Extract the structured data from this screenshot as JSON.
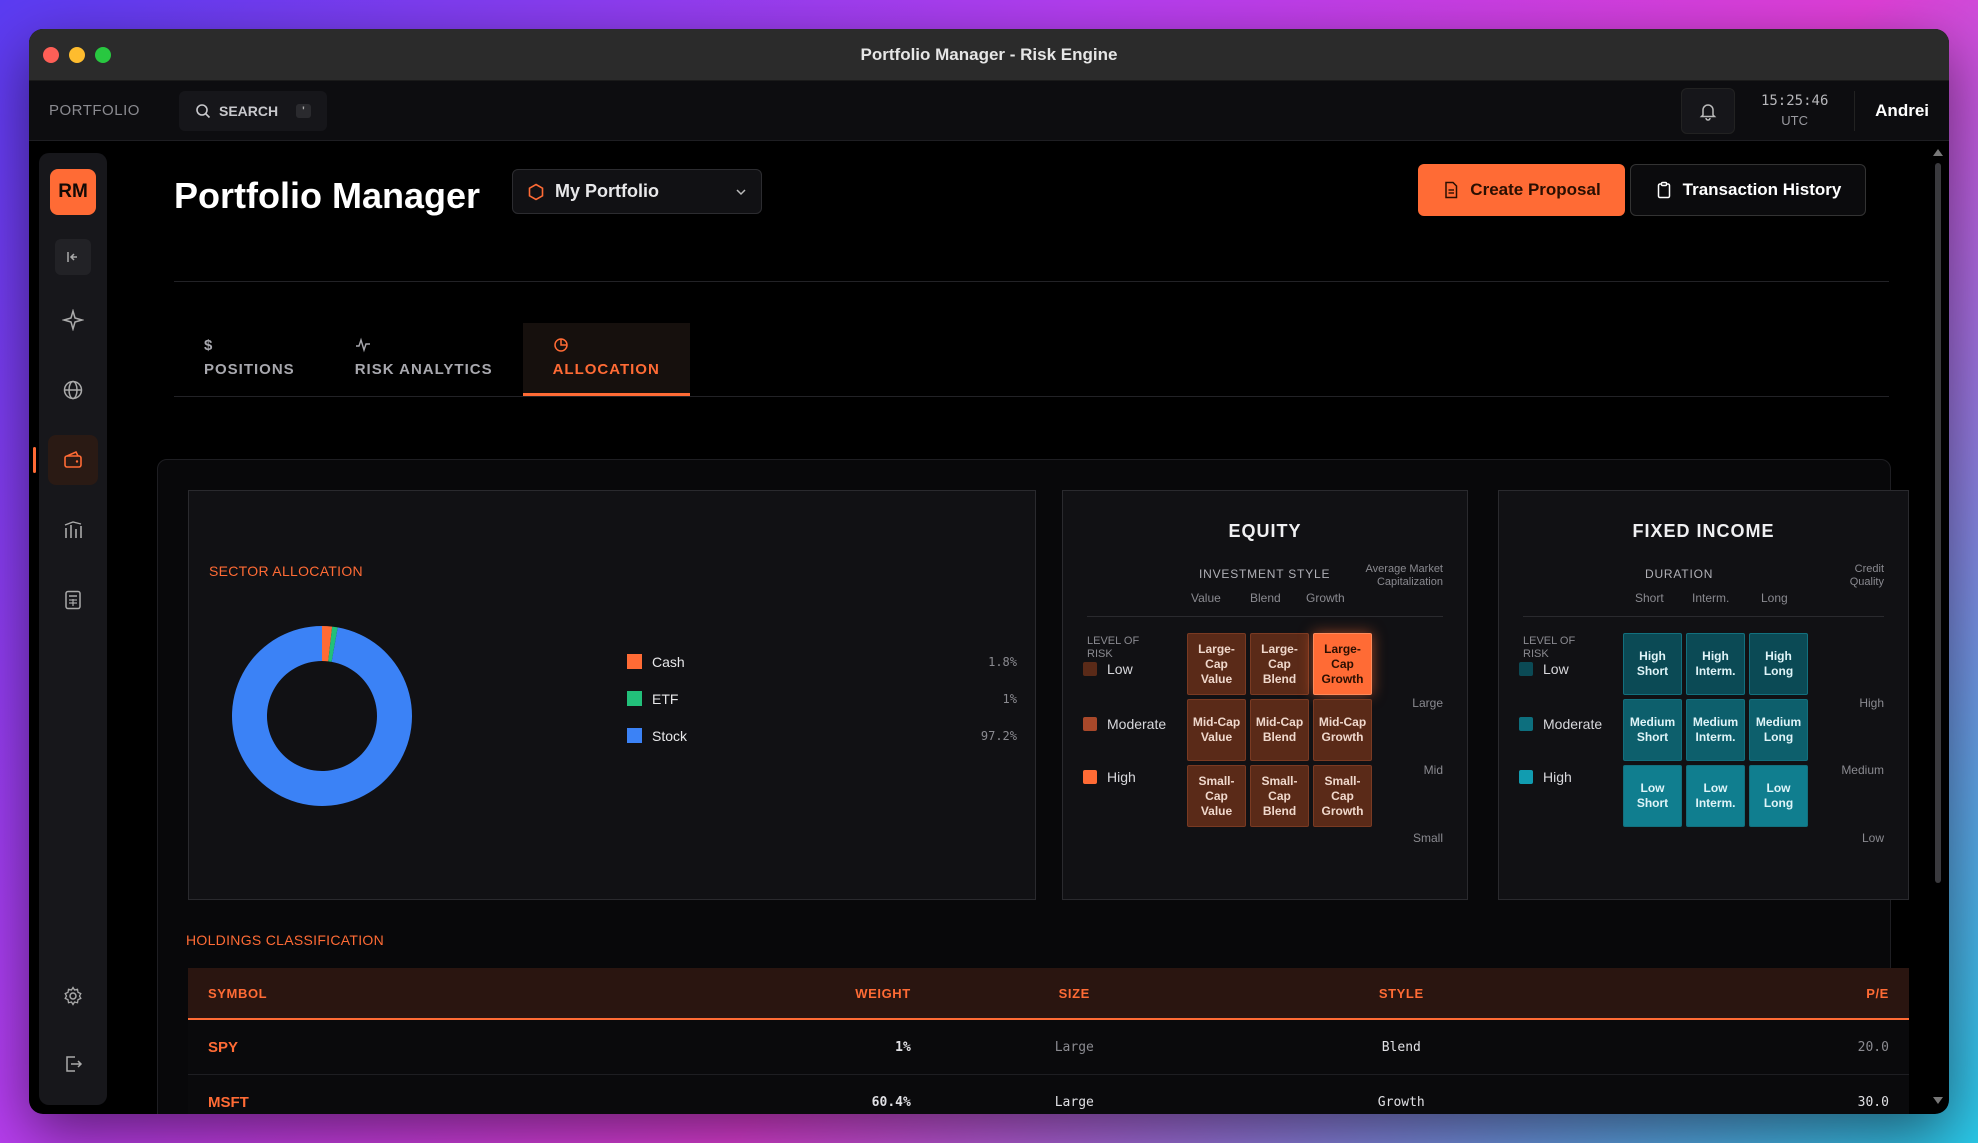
{
  "window": {
    "title": "Portfolio Manager - Risk Engine"
  },
  "topbar": {
    "brand": "PORTFOLIO",
    "search_label": "SEARCH",
    "search_kbd": "'",
    "time": "15:25:46",
    "timezone": "UTC",
    "user": "Andrei"
  },
  "sidebar": {
    "avatar": "RM",
    "items": [
      {
        "name": "collapse",
        "icon": "collapse-icon"
      },
      {
        "name": "sparkle",
        "icon": "sparkle-icon"
      },
      {
        "name": "globe",
        "icon": "globe-icon"
      },
      {
        "name": "wallet",
        "icon": "wallet-icon",
        "active": true
      },
      {
        "name": "analytics",
        "icon": "chart-icon"
      },
      {
        "name": "calculator",
        "icon": "calculator-icon"
      }
    ],
    "bottom": [
      {
        "icon": "gear-icon"
      },
      {
        "icon": "logout-icon"
      }
    ]
  },
  "header": {
    "title": "Portfolio Manager",
    "portfolio_select": "My Portfolio",
    "create_proposal": "Create Proposal",
    "transaction_history": "Transaction History"
  },
  "tabs": [
    {
      "label": "POSITIONS",
      "icon": "$"
    },
    {
      "label": "RISK ANALYTICS",
      "icon": "pulse-icon"
    },
    {
      "label": "ALLOCATION",
      "icon": "pie-icon",
      "active": true
    }
  ],
  "sector": {
    "label": "SECTOR ALLOCATION",
    "items": [
      {
        "name": "Cash",
        "pct": "1.8%",
        "value": 1.8,
        "color": "#ff6b35"
      },
      {
        "name": "ETF",
        "pct": "1%",
        "value": 1.0,
        "color": "#22c07a"
      },
      {
        "name": "Stock",
        "pct": "97.2%",
        "value": 97.2,
        "color": "#3b82f6"
      }
    ]
  },
  "equity": {
    "title": "EQUITY",
    "investment_style": "INVESTMENT STYLE",
    "avg_cap_1": "Average Market",
    "avg_cap_2": "Capitalization",
    "cols": [
      "Value",
      "Blend",
      "Growth"
    ],
    "level_1": "LEVEL OF",
    "level_2": "RISK",
    "risk": [
      {
        "label": "Low",
        "color": "#5a2a18"
      },
      {
        "label": "Moderate",
        "color": "#a8482a"
      },
      {
        "label": "High",
        "color": "#ff6b35"
      }
    ],
    "cells": [
      [
        "Large-Cap Value",
        "Large-Cap Blend",
        "Large-Cap Growth"
      ],
      [
        "Mid-Cap Value",
        "Mid-Cap Blend",
        "Mid-Cap Growth"
      ],
      [
        "Small-Cap Value",
        "Small-Cap Blend",
        "Small-Cap Growth"
      ]
    ],
    "rows_right": [
      "Large",
      "Mid",
      "Small"
    ]
  },
  "fixed": {
    "title": "FIXED INCOME",
    "duration": "DURATION",
    "credit_1": "Credit",
    "credit_2": "Quality",
    "cols": [
      "Short",
      "Interm.",
      "Long"
    ],
    "level_1": "LEVEL OF",
    "level_2": "RISK",
    "risk": [
      {
        "label": "Low",
        "color": "#0b4a55"
      },
      {
        "label": "Moderate",
        "color": "#0d6f7e"
      },
      {
        "label": "High",
        "color": "#119cb0"
      }
    ],
    "cells": [
      [
        "High Short",
        "High Interm.",
        "High Long"
      ],
      [
        "Medium Short",
        "Medium Interm.",
        "Medium Long"
      ],
      [
        "Low Short",
        "Low Interm.",
        "Low Long"
      ]
    ],
    "rows_right": [
      "High",
      "Medium",
      "Low"
    ]
  },
  "holdings": {
    "label": "HOLDINGS CLASSIFICATION",
    "columns": [
      "SYMBOL",
      "WEIGHT",
      "SIZE",
      "STYLE",
      "P/E"
    ],
    "rows": [
      [
        "SPY",
        "1%",
        "Large",
        "Blend",
        "20.0"
      ],
      [
        "MSFT",
        "60.4%",
        "Large",
        "Growth",
        "30.0"
      ]
    ]
  }
}
